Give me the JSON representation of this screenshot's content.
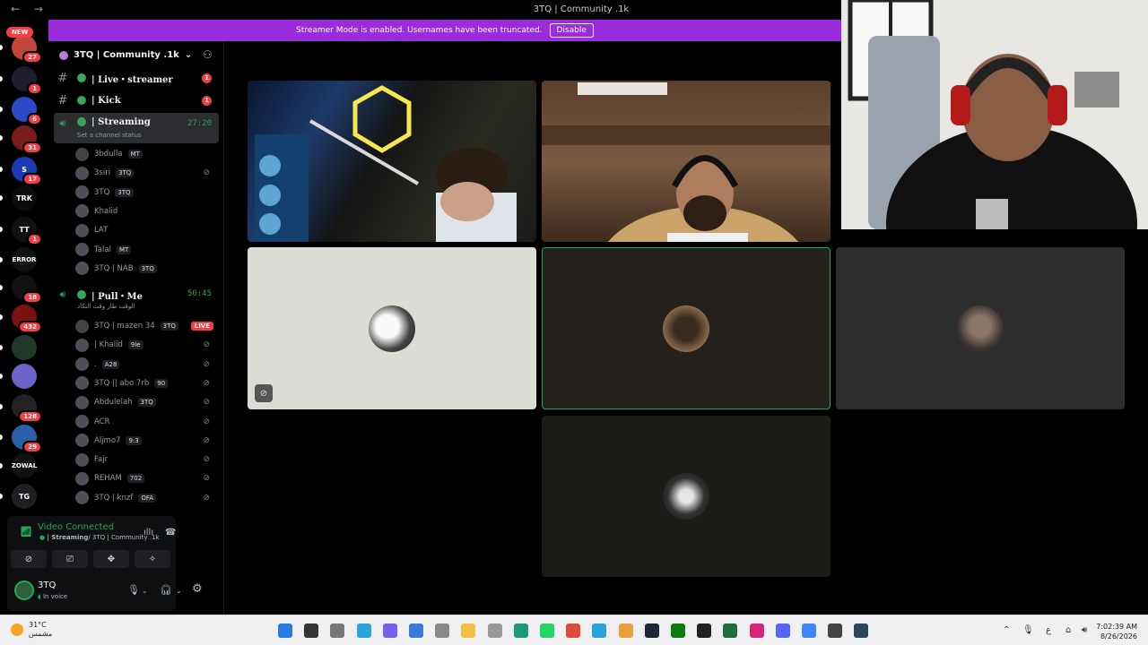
{
  "window": {
    "title": "3TQ | Community .1k",
    "nav": "← →"
  },
  "banner": {
    "text": "Streamer Mode is enabled. Usernames have been truncated.",
    "button": "Disable"
  },
  "rail": {
    "new_tag": "NEW",
    "servers": [
      {
        "label": "",
        "badge": "27",
        "color": "#c2453a"
      },
      {
        "label": "",
        "badge": "1",
        "color": "#1d1d2e"
      },
      {
        "label": "",
        "badge": "6",
        "color": "#2a4ac9"
      },
      {
        "label": "",
        "badge": "31",
        "color": "#7a1c1c"
      },
      {
        "label": "S",
        "badge": "17",
        "color": "#1a3bb5"
      },
      {
        "label": "TRK",
        "badge": "",
        "color": "#0c0c0c"
      },
      {
        "label": "TT",
        "badge": "1",
        "color": "#111"
      },
      {
        "label": "ERROR",
        "badge": "",
        "color": "#111"
      },
      {
        "label": "",
        "badge": "18",
        "color": "#111"
      },
      {
        "label": "",
        "badge": "432",
        "color": "#7a1212"
      },
      {
        "label": "",
        "badge": "",
        "color": "#1f3a2b"
      },
      {
        "label": "",
        "badge": "",
        "color": "#6d63c9"
      },
      {
        "label": "",
        "badge": "128",
        "color": "#222"
      },
      {
        "label": "",
        "badge": "29",
        "color": "#2b5fa8"
      },
      {
        "label": "ZOWAL",
        "badge": "",
        "color": "#111"
      },
      {
        "label": "TG",
        "badge": "",
        "color": "#1e1f22"
      }
    ]
  },
  "sidebar": {
    "server_name": "3TQ | Community .1k",
    "channels": [
      {
        "name": "| Live・streamer",
        "unread": "1"
      },
      {
        "name": "| Kick",
        "unread": "1"
      }
    ],
    "voice1": {
      "name": "| Streaming",
      "timer": "27:20",
      "status": "Set a channel status"
    },
    "voice1_members": [
      {
        "name": "3bdulla",
        "tag": "MT",
        "mute": false
      },
      {
        "name": "3siri",
        "tag": "3TQ",
        "mute": true
      },
      {
        "name": "3TQ",
        "tag": "3TQ",
        "mute": false
      },
      {
        "name": "Khalid",
        "tag": "",
        "mute": false
      },
      {
        "name": "LAT",
        "tag": "",
        "mute": false
      },
      {
        "name": "Talal",
        "tag": "MT",
        "mute": false
      },
      {
        "name": "3TQ | NAB",
        "tag": "3TQ",
        "mute": false
      }
    ],
    "voice2": {
      "name": "| Pull・Me",
      "timer": "50:45",
      "status": "الوقت طار وقت النكاد"
    },
    "voice2_members": [
      {
        "name": "3TQ | mazen 34",
        "tag": "3TQ",
        "live": "LIVE"
      },
      {
        "name": "| Khalid",
        "tag": "9le",
        "live": ""
      },
      {
        "name": ".",
        "tag": "A28",
        "live": ""
      },
      {
        "name": "3TQ || abo 7rb",
        "tag": "90",
        "live": ""
      },
      {
        "name": "Abdulelah",
        "tag": "3TQ",
        "live": ""
      },
      {
        "name": "ACR",
        "tag": "",
        "live": ""
      },
      {
        "name": "Aljmo7",
        "tag": "9:3",
        "live": ""
      },
      {
        "name": "Fajr",
        "tag": "",
        "live": ""
      },
      {
        "name": "REHAM",
        "tag": "702",
        "live": ""
      },
      {
        "name": "3TQ | knzf",
        "tag": "OFA",
        "live": ""
      }
    ]
  },
  "voice_panel": {
    "title": "Video Connected",
    "channel": "| Streaming",
    "path": "/ 3TQ | Community .1k"
  },
  "user": {
    "name": "3TQ",
    "status": "In voice"
  },
  "taskbar": {
    "temp": "31°C",
    "weather": "مشمس",
    "time": "7:02:39 AM",
    "date": "8/26/2026",
    "lang": "ع",
    "apps": [
      {
        "icon": "windows-icon",
        "color": "#2b7be4"
      },
      {
        "icon": "search-icon",
        "color": "#333"
      },
      {
        "icon": "task-view-icon",
        "color": "#777"
      },
      {
        "icon": "telegram-icon",
        "color": "#2aa3dd"
      },
      {
        "icon": "copilot-icon",
        "color": "#7a5de8"
      },
      {
        "icon": "store-icon",
        "color": "#3b78d8"
      },
      {
        "icon": "file-icon",
        "color": "#888"
      },
      {
        "icon": "folder-icon",
        "color": "#f2c144"
      },
      {
        "icon": "app-icon",
        "color": "#999"
      },
      {
        "icon": "edge-icon",
        "color": "#1d9a7a"
      },
      {
        "icon": "whatsapp-icon",
        "color": "#25d366"
      },
      {
        "icon": "chrome-icon",
        "color": "#dd4b39"
      },
      {
        "icon": "telegram-icon",
        "color": "#2aa3dd"
      },
      {
        "icon": "chrome-icon",
        "color": "#e8a23b"
      },
      {
        "icon": "steam-icon",
        "color": "#1b2838"
      },
      {
        "icon": "xbox-icon",
        "color": "#107c10"
      },
      {
        "icon": "epic-icon",
        "color": "#222"
      },
      {
        "icon": "excel-icon",
        "color": "#1d6f42"
      },
      {
        "icon": "instagram-icon",
        "color": "#d6287a"
      },
      {
        "icon": "discord-icon",
        "color": "#5865f2"
      },
      {
        "icon": "chrome-icon",
        "color": "#4285f4"
      },
      {
        "icon": "obs-icon",
        "color": "#444"
      },
      {
        "icon": "steam-icon",
        "color": "#2a475e"
      }
    ]
  }
}
